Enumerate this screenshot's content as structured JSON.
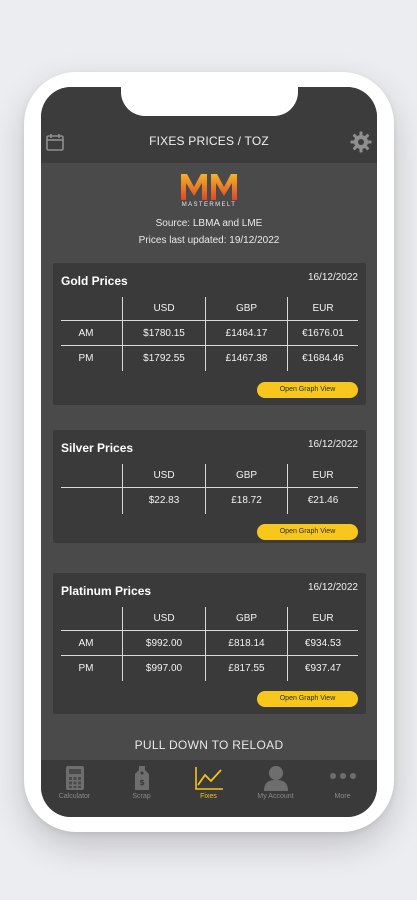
{
  "header": {
    "title": "FIXES PRICES / TOZ"
  },
  "logo": {
    "text": "MASTERMELT"
  },
  "source": "Source: LBMA and LME",
  "updated": "Prices last updated: 19/12/2022",
  "headers": {
    "usd": "USD",
    "gbp": "GBP",
    "eur": "EUR"
  },
  "cards": {
    "gold": {
      "title": "Gold Prices",
      "date": "16/12/2022",
      "rows": [
        {
          "label": "AM",
          "usd": "$1780.15",
          "gbp": "£1464.17",
          "eur": "€1676.01"
        },
        {
          "label": "PM",
          "usd": "$1792.55",
          "gbp": "£1467.38",
          "eur": "€1684.46"
        }
      ],
      "button": "Open Graph View"
    },
    "silver": {
      "title": "Silver Prices",
      "date": "16/12/2022",
      "rows": [
        {
          "label": "",
          "usd": "$22.83",
          "gbp": "£18.72",
          "eur": "€21.46"
        }
      ],
      "button": "Open Graph View"
    },
    "platinum": {
      "title": "Platinum Prices",
      "date": "16/12/2022",
      "rows": [
        {
          "label": "AM",
          "usd": "$992.00",
          "gbp": "£818.14",
          "eur": "€934.53"
        },
        {
          "label": "PM",
          "usd": "$997.00",
          "gbp": "£817.55",
          "eur": "€937.47"
        }
      ],
      "button": "Open Graph View"
    }
  },
  "reload": "PULL DOWN TO RELOAD",
  "tabs": [
    {
      "label": "Calculator",
      "icon": "calculator-icon",
      "active": false
    },
    {
      "label": "Scrap",
      "icon": "scrap-tag-icon",
      "active": false
    },
    {
      "label": "Fixes",
      "icon": "chart-line-icon",
      "active": true
    },
    {
      "label": "My Account",
      "icon": "user-icon",
      "active": false
    },
    {
      "label": "More",
      "icon": "more-dots-icon",
      "active": false
    }
  ],
  "colors": {
    "accent": "#f7c81b",
    "background": "#4a4a4a",
    "card": "#3a3a3a"
  }
}
